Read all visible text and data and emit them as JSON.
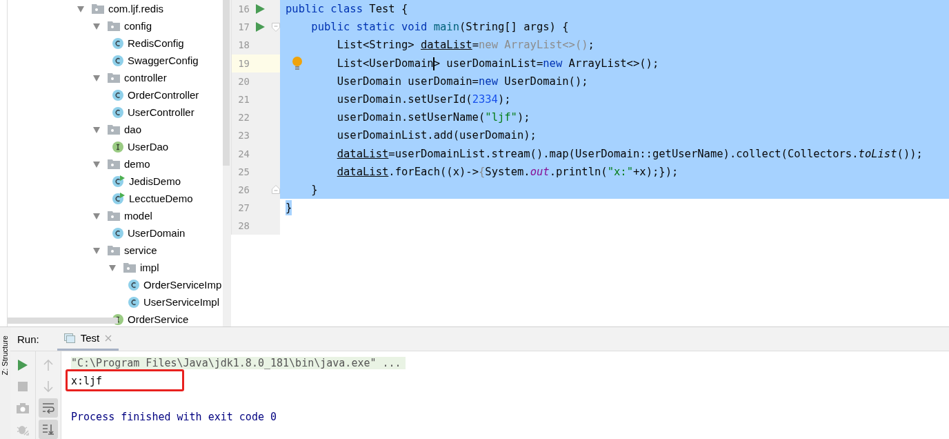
{
  "project_tree": [
    {
      "label": "com.ljf.redis",
      "kind": "package",
      "expanded": true,
      "children": [
        {
          "label": "config",
          "kind": "package",
          "expanded": true,
          "children": [
            {
              "label": "RedisConfig",
              "kind": "class"
            },
            {
              "label": "SwaggerConfig",
              "kind": "class"
            }
          ]
        },
        {
          "label": "controller",
          "kind": "package",
          "expanded": true,
          "children": [
            {
              "label": "OrderController",
              "kind": "class"
            },
            {
              "label": "UserController",
              "kind": "class"
            }
          ]
        },
        {
          "label": "dao",
          "kind": "package",
          "expanded": true,
          "children": [
            {
              "label": "UserDao",
              "kind": "interface"
            }
          ]
        },
        {
          "label": "demo",
          "kind": "package",
          "expanded": true,
          "children": [
            {
              "label": "JedisDemo",
              "kind": "runnable"
            },
            {
              "label": "LecctueDemo",
              "kind": "runnable"
            }
          ]
        },
        {
          "label": "model",
          "kind": "package",
          "expanded": true,
          "children": [
            {
              "label": "UserDomain",
              "kind": "class"
            }
          ]
        },
        {
          "label": "service",
          "kind": "package",
          "expanded": true,
          "children": [
            {
              "label": "impl",
              "kind": "package",
              "expanded": true,
              "children": [
                {
                  "label": "OrderServiceImp",
                  "kind": "class"
                },
                {
                  "label": "UserServiceImpl",
                  "kind": "class"
                }
              ]
            },
            {
              "label": "OrderService",
              "kind": "interface"
            }
          ]
        }
      ]
    }
  ],
  "side_tab": "Z: Structure",
  "editor": {
    "lines": [
      {
        "number": "16",
        "kind": "selected",
        "run": true,
        "fold_start": false,
        "fold_end": false,
        "current": false,
        "bulb": false,
        "tokens": [
          {
            "text": "public class ",
            "kind": "kw"
          },
          {
            "text": "Test {",
            "kind": "plain"
          }
        ]
      },
      {
        "number": "17",
        "kind": "selected",
        "run": true,
        "fold_start": true,
        "fold_end": false,
        "current": false,
        "bulb": false,
        "tokens": [
          {
            "text": "    public static void ",
            "kind": "kw"
          },
          {
            "text": "main",
            "kind": "method"
          },
          {
            "text": "(String[] args) {",
            "kind": "plain"
          }
        ]
      },
      {
        "number": "18",
        "kind": "selected",
        "run": false,
        "fold_start": false,
        "fold_end": false,
        "current": false,
        "bulb": false,
        "tokens": [
          {
            "text": "        List<String> ",
            "kind": "plain"
          },
          {
            "text": "dataList",
            "kind": "reassigned"
          },
          {
            "text": "=",
            "kind": "plain"
          },
          {
            "text": "new ArrayList<>()",
            "kind": "gray"
          },
          {
            "text": ";",
            "kind": "plain"
          }
        ]
      },
      {
        "number": "19",
        "kind": "selected",
        "run": false,
        "fold_start": false,
        "fold_end": false,
        "current": true,
        "bulb": true,
        "tokens": [
          {
            "text": "        List<UserDomain",
            "kind": "plain"
          },
          {
            "kind": "caret"
          },
          {
            "text": "> userDomainList=",
            "kind": "plain"
          },
          {
            "text": "new ",
            "kind": "kw"
          },
          {
            "text": "ArrayList<>();",
            "kind": "plain"
          }
        ]
      },
      {
        "number": "20",
        "kind": "selected",
        "run": false,
        "fold_start": false,
        "fold_end": false,
        "current": false,
        "bulb": false,
        "tokens": [
          {
            "text": "        UserDomain userDomain=",
            "kind": "plain"
          },
          {
            "text": "new ",
            "kind": "kw"
          },
          {
            "text": "UserDomain();",
            "kind": "plain"
          }
        ]
      },
      {
        "number": "21",
        "kind": "selected",
        "run": false,
        "fold_start": false,
        "fold_end": false,
        "current": false,
        "bulb": false,
        "tokens": [
          {
            "text": "        userDomain.setUserId(",
            "kind": "plain"
          },
          {
            "text": "2334",
            "kind": "num"
          },
          {
            "text": ");",
            "kind": "plain"
          }
        ]
      },
      {
        "number": "22",
        "kind": "selected",
        "run": false,
        "fold_start": false,
        "fold_end": false,
        "current": false,
        "bulb": false,
        "tokens": [
          {
            "text": "        userDomain.setUserName(",
            "kind": "plain"
          },
          {
            "text": "\"ljf\"",
            "kind": "str"
          },
          {
            "text": ");",
            "kind": "plain"
          }
        ]
      },
      {
        "number": "23",
        "kind": "selected",
        "run": false,
        "fold_start": false,
        "fold_end": false,
        "current": false,
        "bulb": false,
        "tokens": [
          {
            "text": "        userDomainList.add(userDomain);",
            "kind": "plain"
          }
        ]
      },
      {
        "number": "24",
        "kind": "selected",
        "run": false,
        "fold_start": false,
        "fold_end": false,
        "current": false,
        "bulb": false,
        "tokens": [
          {
            "text": "        dataList",
            "kind": "reassigned"
          },
          {
            "text": "=userDomainList.stream().map(UserDomain::getUserName).collect(Collectors.",
            "kind": "plain"
          },
          {
            "text": "toList",
            "kind": "static"
          },
          {
            "text": "());",
            "kind": "plain"
          }
        ]
      },
      {
        "number": "25",
        "kind": "selected",
        "run": false,
        "fold_start": false,
        "fold_end": false,
        "current": false,
        "bulb": false,
        "tokens": [
          {
            "text": "        dataList",
            "kind": "reassigned"
          },
          {
            "text": ".forEach((x)->",
            "kind": "plain"
          },
          {
            "text": "{",
            "kind": "gray"
          },
          {
            "text": "System.",
            "kind": "plain"
          },
          {
            "text": "out",
            "kind": "field"
          },
          {
            "text": ".println(",
            "kind": "plain"
          },
          {
            "text": "\"x:\"",
            "kind": "str"
          },
          {
            "text": "+x);});",
            "kind": "plain"
          }
        ]
      },
      {
        "number": "26",
        "kind": "selected",
        "run": false,
        "fold_start": false,
        "fold_end": true,
        "current": false,
        "bulb": false,
        "tokens": [
          {
            "text": "    }",
            "kind": "plain"
          }
        ]
      },
      {
        "number": "27",
        "kind": "selected-text",
        "run": false,
        "fold_start": false,
        "fold_end": false,
        "current": false,
        "bulb": false,
        "tokens": [
          {
            "text": "}",
            "kind": "plain"
          }
        ]
      },
      {
        "number": "28",
        "kind": "plain",
        "run": false,
        "fold_start": false,
        "fold_end": false,
        "current": false,
        "bulb": false
      }
    ]
  },
  "run_panel": {
    "label": "Run:",
    "tabs": [
      {
        "label": "Test",
        "selected": true,
        "closable": true
      }
    ],
    "tools_left": [
      {
        "kind": "rerun"
      },
      {
        "kind": "stop"
      },
      {
        "kind": "camera"
      },
      {
        "kind": "debug"
      }
    ],
    "tools_right": [
      {
        "kind": "up",
        "on": false
      },
      {
        "kind": "down",
        "on": false
      },
      {
        "kind": "wrap",
        "on": true
      },
      {
        "kind": "scroll-end",
        "on": true
      }
    ],
    "console": [
      {
        "text": "\"C:\\Program Files\\Java\\jdk1.8.0_181\\bin\\java.exe\" ...",
        "kind": "command",
        "annotated": false
      },
      {
        "text": "x:ljf",
        "kind": "output",
        "annotated": true
      },
      {
        "kind": "blank",
        "annotated": false
      },
      {
        "text": "Process finished with exit code 0",
        "kind": "exit",
        "annotated": false
      }
    ]
  }
}
